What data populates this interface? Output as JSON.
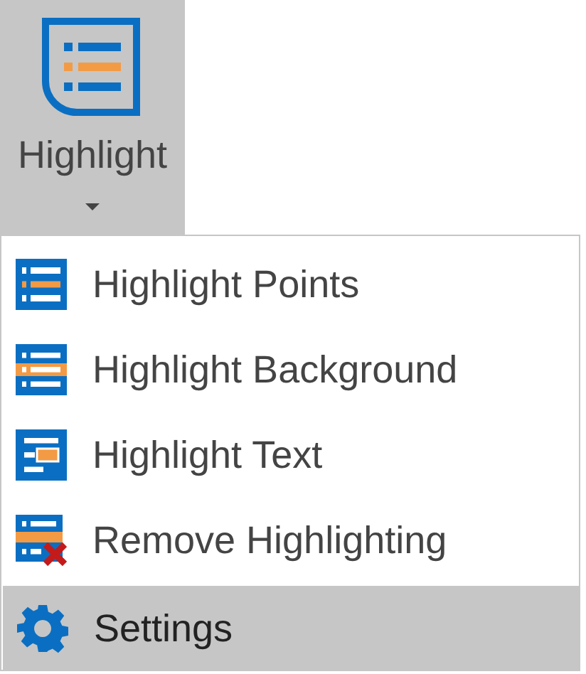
{
  "ribbon_button": {
    "label": "Highlight",
    "expanded": true
  },
  "menu": {
    "items": [
      {
        "kind": "points",
        "label": "Highlight Points",
        "selected": false
      },
      {
        "kind": "background",
        "label": "Highlight Background",
        "selected": false
      },
      {
        "kind": "text",
        "label": "Highlight Text",
        "selected": false
      },
      {
        "kind": "remove",
        "label": "Remove Highlighting",
        "selected": false
      }
    ],
    "footer": [
      {
        "kind": "settings",
        "label": "Settings",
        "selected": true
      }
    ]
  }
}
